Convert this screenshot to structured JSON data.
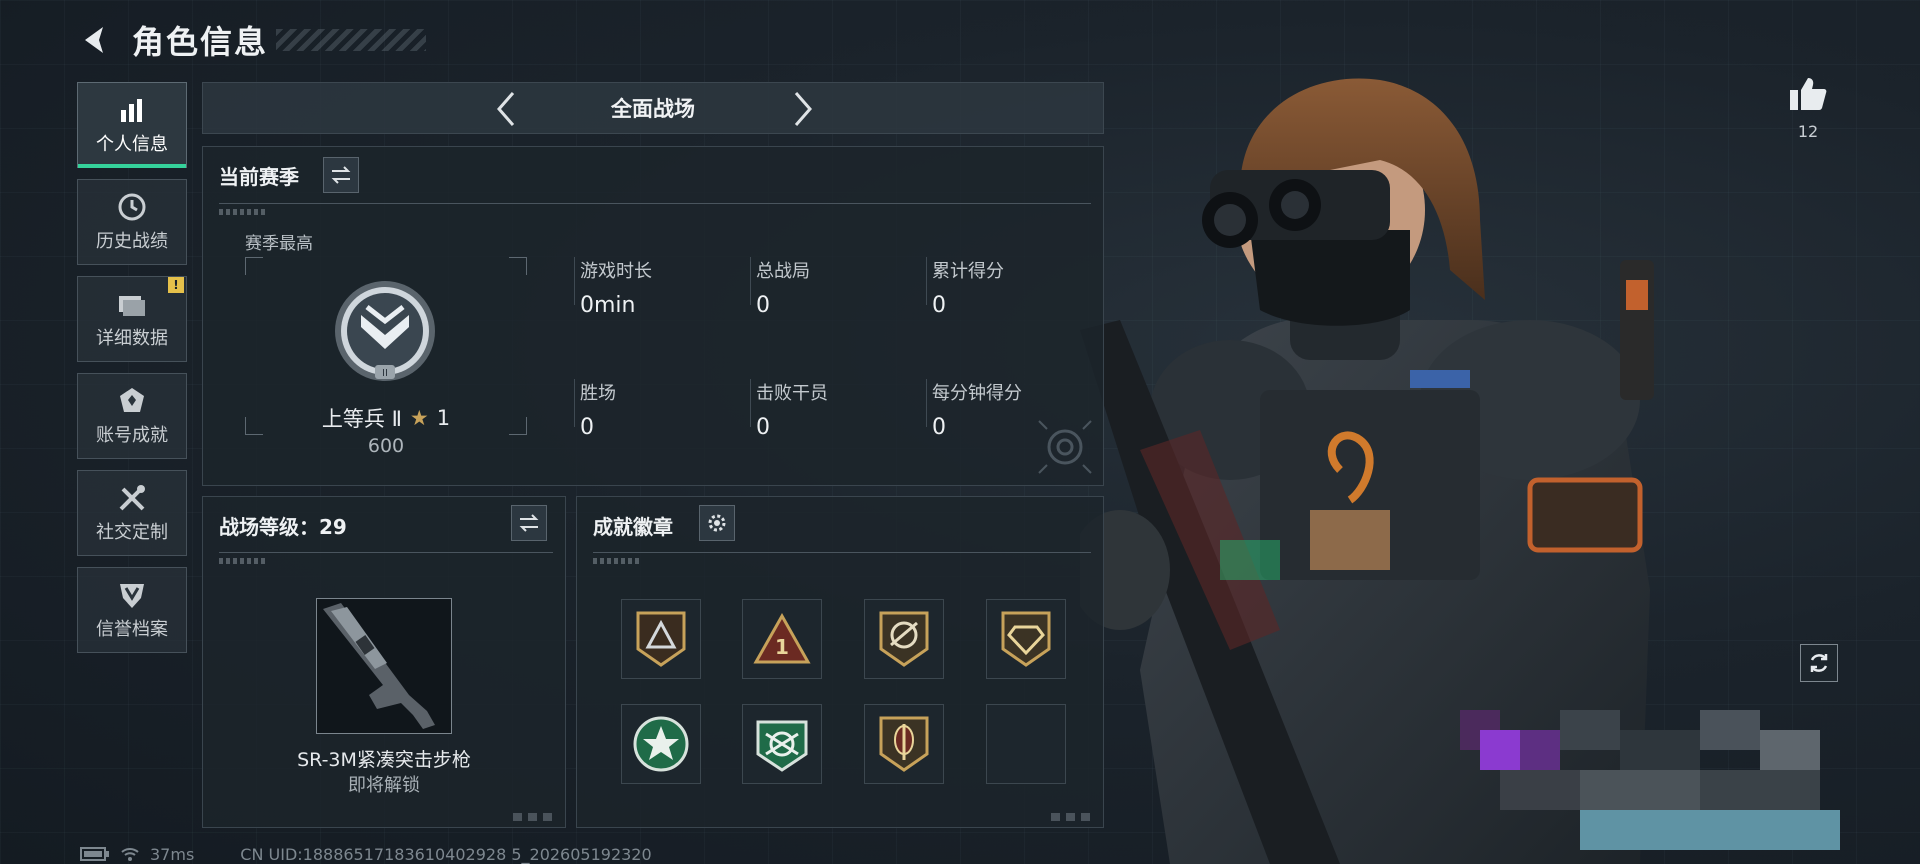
{
  "header": {
    "title": "角色信息",
    "back_icon": "back-arrow-icon"
  },
  "sidebar": {
    "items": [
      {
        "label": "个人信息",
        "icon": "bar-chart-icon",
        "active": true
      },
      {
        "label": "历史战绩",
        "icon": "clock-icon"
      },
      {
        "label": "详细数据",
        "icon": "folder-icon",
        "badge": "!"
      },
      {
        "label": "账号成就",
        "icon": "achievement-icon"
      },
      {
        "label": "社交定制",
        "icon": "tools-icon"
      },
      {
        "label": "信誉档案",
        "icon": "shield-icon"
      }
    ]
  },
  "mode": {
    "title": "全面战场"
  },
  "season": {
    "title": "当前赛季",
    "best_label": "赛季最高",
    "rank_name": "上等兵 Ⅱ",
    "rank_stars": "1",
    "rank_score": "600",
    "stats": [
      {
        "label": "游戏时长",
        "value": "0min"
      },
      {
        "label": "总战局",
        "value": "0"
      },
      {
        "label": "累计得分",
        "value": "0"
      },
      {
        "label": "胜场",
        "value": "0"
      },
      {
        "label": "击败干员",
        "value": "0"
      },
      {
        "label": "每分钟得分",
        "value": "0"
      }
    ]
  },
  "level": {
    "title": "战场等级：29",
    "weapon_name": "SR-3M紧凑突击步枪",
    "weapon_status": "即将解锁"
  },
  "badges": {
    "title": "成就徽章",
    "items": [
      "triangle-badge-icon",
      "number-one-badge-icon",
      "rifle-badge-icon",
      "gem-badge-icon",
      "star-badge-icon",
      "arrows-badge-icon",
      "sword-badge-icon",
      "empty-badge-slot"
    ]
  },
  "likes": {
    "count": "12",
    "icon": "thumbs-up-icon"
  },
  "footer": {
    "ping": "37ms",
    "uid": "CN UID:18886517183610402928 5_202605192320"
  },
  "colors": {
    "accent": "#35d29b",
    "gold": "#c7a25a",
    "bg": "#1b232b"
  }
}
